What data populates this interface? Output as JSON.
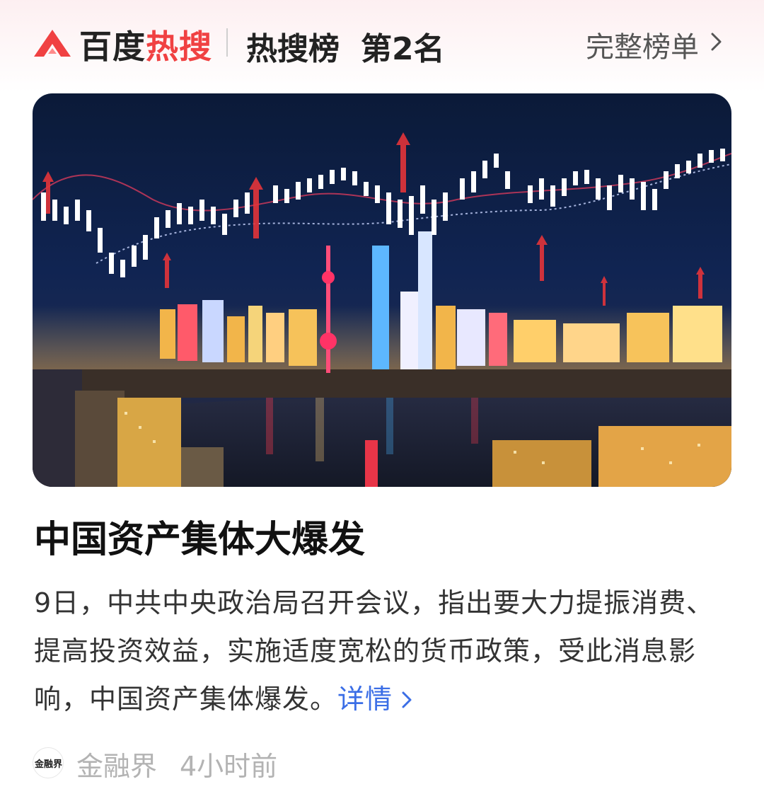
{
  "header": {
    "brand_part1": "百度",
    "brand_part2": "热搜",
    "list_name": "热搜榜",
    "rank": "第2名",
    "full_list_label": "完整榜单"
  },
  "hero": {
    "icon": "stock-chart-over-city-night-image"
  },
  "article": {
    "headline": "中国资产集体大爆发",
    "summary": "9日，中共中央政治局召开会议，指出要大力提振消费、提高投资效益，实施适度宽松的货币政策，受此消息影响，中国资产集体爆发。",
    "more_label": "详情"
  },
  "source": {
    "avatar_text": "金融界",
    "name": "金融界",
    "time": "4小时前"
  },
  "colors": {
    "brand_red": "#f04142",
    "link_blue": "#3b6ee6",
    "muted_gray": "#b3b3b3"
  }
}
